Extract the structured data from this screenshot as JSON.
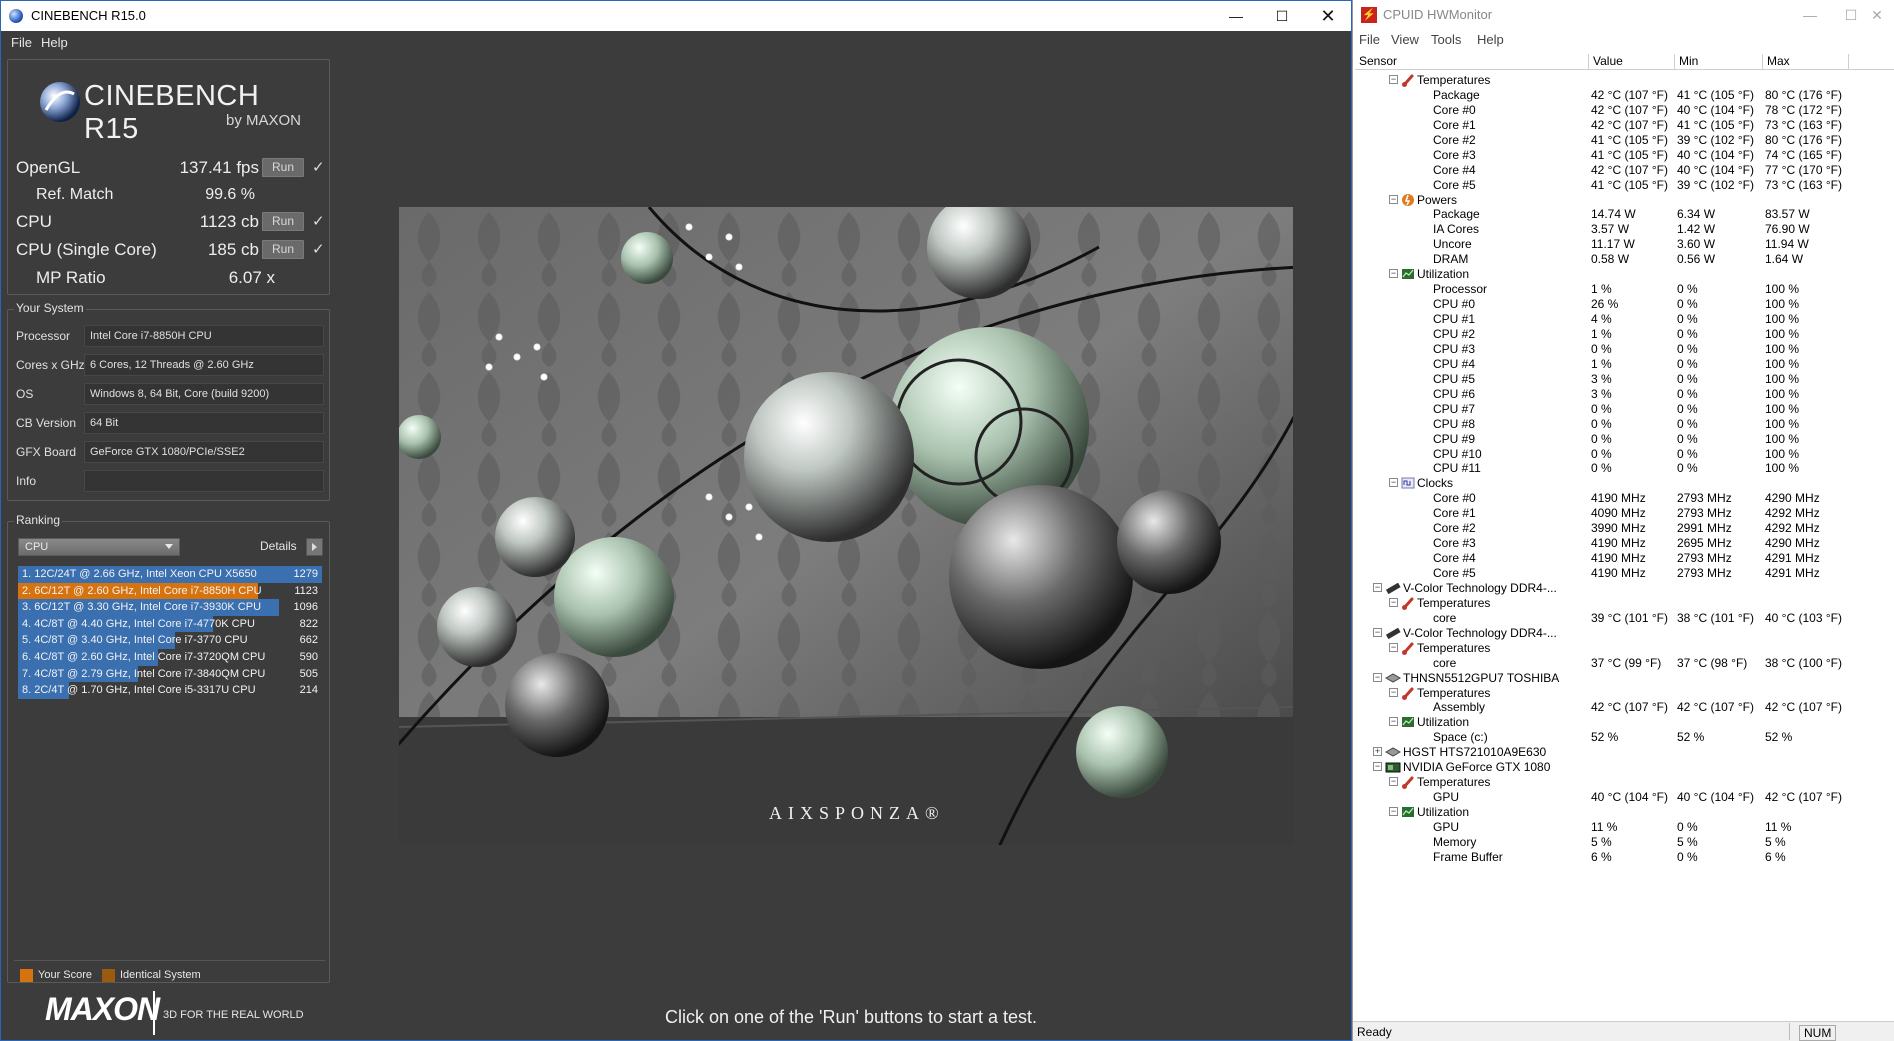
{
  "cinebench": {
    "title": "CINEBENCH R15.0",
    "menu": [
      "File",
      "Help"
    ],
    "logo": {
      "name": "CINEBENCH R15",
      "sub": "by MAXON"
    },
    "scores": [
      {
        "label": "OpenGL",
        "value": "137.41 fps",
        "run": "Run",
        "check": "✓"
      },
      {
        "label": "Ref. Match",
        "value": "99.6 %"
      },
      {
        "label": "CPU",
        "value": "1123 cb",
        "run": "Run",
        "check": "✓"
      },
      {
        "label": "CPU (Single Core)",
        "value": "185 cb",
        "run": "Run",
        "check": "✓"
      },
      {
        "label": "MP Ratio",
        "value": "6.07 x"
      }
    ],
    "your_system": {
      "heading": "Your System",
      "rows": [
        {
          "key": "Processor",
          "value": "Intel Core i7-8850H CPU"
        },
        {
          "key": "Cores x GHz",
          "value": "6 Cores, 12 Threads @ 2.60 GHz"
        },
        {
          "key": "OS",
          "value": "Windows 8, 64 Bit, Core (build 9200)"
        },
        {
          "key": "CB Version",
          "value": "64 Bit"
        },
        {
          "key": "GFX Board",
          "value": "GeForce GTX 1080/PCIe/SSE2"
        },
        {
          "key": "Info",
          "value": ""
        }
      ]
    },
    "ranking": {
      "heading": "Ranking",
      "select": "CPU",
      "details": "Details",
      "rows": [
        {
          "text": "1. 12C/24T @ 2.66 GHz, Intel Xeon CPU X5650",
          "score": 1279,
          "type": "other"
        },
        {
          "text": "2. 6C/12T @ 2.60 GHz, Intel Core i7-8850H CPU",
          "score": 1123,
          "type": "yours"
        },
        {
          "text": "3. 6C/12T @ 3.30 GHz,  Intel Core i7-3930K CPU",
          "score": 1096,
          "type": "other"
        },
        {
          "text": "4. 4C/8T @ 4.40 GHz, Intel Core i7-4770K CPU",
          "score": 822,
          "type": "other"
        },
        {
          "text": "5. 4C/8T @ 3.40 GHz,  Intel Core i7-3770 CPU",
          "score": 662,
          "type": "other"
        },
        {
          "text": "6. 4C/8T @ 2.60 GHz, Intel Core i7-3720QM CPU",
          "score": 590,
          "type": "other"
        },
        {
          "text": "7. 4C/8T @ 2.79 GHz, Intel Core i7-3840QM CPU",
          "score": 505,
          "type": "other"
        },
        {
          "text": "8. 2C/4T @ 1.70 GHz,  Intel Core i5-3317U CPU",
          "score": 214,
          "type": "other"
        }
      ],
      "legend": {
        "yours": "Your Score",
        "identical": "Identical System"
      }
    },
    "brand": {
      "logo": "MAXON",
      "tagline": "3D FOR THE REAL WORLD"
    },
    "render_watermark": "AIXSPONZA®",
    "status": "Click on one of the 'Run' buttons to start a test.",
    "colors": {
      "bg": "#3c3c3c",
      "bar_other": "#3a6fb0",
      "bar_yours": "#d6730f",
      "identical": "#9a5a10"
    }
  },
  "hwmonitor": {
    "title": "CPUID HWMonitor",
    "menu": [
      "File",
      "View",
      "Tools",
      "Help"
    ],
    "columns": [
      "Sensor",
      "Value",
      "Min",
      "Max"
    ],
    "status": "Ready",
    "status_right": "NUM",
    "rows": [
      {
        "lv": 2,
        "kind": "group",
        "icon": "thermometer-icon",
        "name": "Temperatures"
      },
      {
        "lv": 3,
        "name": "Package",
        "v": "42 °C  (107 °F)",
        "min": "41 °C  (105 °F)",
        "max": "80 °C  (176 °F)"
      },
      {
        "lv": 3,
        "name": "Core #0",
        "v": "42 °C  (107 °F)",
        "min": "40 °C  (104 °F)",
        "max": "78 °C  (172 °F)"
      },
      {
        "lv": 3,
        "name": "Core #1",
        "v": "42 °C  (107 °F)",
        "min": "41 °C  (105 °F)",
        "max": "73 °C  (163 °F)"
      },
      {
        "lv": 3,
        "name": "Core #2",
        "v": "41 °C  (105 °F)",
        "min": "39 °C  (102 °F)",
        "max": "80 °C  (176 °F)"
      },
      {
        "lv": 3,
        "name": "Core #3",
        "v": "41 °C  (105 °F)",
        "min": "40 °C  (104 °F)",
        "max": "74 °C  (165 °F)"
      },
      {
        "lv": 3,
        "name": "Core #4",
        "v": "42 °C  (107 °F)",
        "min": "40 °C  (104 °F)",
        "max": "77 °C  (170 °F)"
      },
      {
        "lv": 3,
        "name": "Core #5",
        "v": "41 °C  (105 °F)",
        "min": "39 °C  (102 °F)",
        "max": "73 °C  (163 °F)"
      },
      {
        "lv": 2,
        "kind": "group",
        "icon": "power-icon",
        "name": "Powers"
      },
      {
        "lv": 3,
        "name": "Package",
        "v": "14.74 W",
        "min": "6.34 W",
        "max": "83.57 W"
      },
      {
        "lv": 3,
        "name": "IA Cores",
        "v": "3.57 W",
        "min": "1.42 W",
        "max": "76.90 W"
      },
      {
        "lv": 3,
        "name": "Uncore",
        "v": "11.17 W",
        "min": "3.60 W",
        "max": "11.94 W"
      },
      {
        "lv": 3,
        "name": "DRAM",
        "v": "0.58 W",
        "min": "0.56 W",
        "max": "1.64 W"
      },
      {
        "lv": 2,
        "kind": "group",
        "icon": "utilization-icon",
        "name": "Utilization"
      },
      {
        "lv": 3,
        "name": "Processor",
        "v": "1 %",
        "min": "0 %",
        "max": "100 %"
      },
      {
        "lv": 3,
        "name": "CPU #0",
        "v": "26 %",
        "min": "0 %",
        "max": "100 %"
      },
      {
        "lv": 3,
        "name": "CPU #1",
        "v": "4 %",
        "min": "0 %",
        "max": "100 %"
      },
      {
        "lv": 3,
        "name": "CPU #2",
        "v": "1 %",
        "min": "0 %",
        "max": "100 %"
      },
      {
        "lv": 3,
        "name": "CPU #3",
        "v": "0 %",
        "min": "0 %",
        "max": "100 %"
      },
      {
        "lv": 3,
        "name": "CPU #4",
        "v": "1 %",
        "min": "0 %",
        "max": "100 %"
      },
      {
        "lv": 3,
        "name": "CPU #5",
        "v": "3 %",
        "min": "0 %",
        "max": "100 %"
      },
      {
        "lv": 3,
        "name": "CPU #6",
        "v": "3 %",
        "min": "0 %",
        "max": "100 %"
      },
      {
        "lv": 3,
        "name": "CPU #7",
        "v": "0 %",
        "min": "0 %",
        "max": "100 %"
      },
      {
        "lv": 3,
        "name": "CPU #8",
        "v": "0 %",
        "min": "0 %",
        "max": "100 %"
      },
      {
        "lv": 3,
        "name": "CPU #9",
        "v": "0 %",
        "min": "0 %",
        "max": "100 %"
      },
      {
        "lv": 3,
        "name": "CPU #10",
        "v": "0 %",
        "min": "0 %",
        "max": "100 %"
      },
      {
        "lv": 3,
        "name": "CPU #11",
        "v": "0 %",
        "min": "0 %",
        "max": "100 %"
      },
      {
        "lv": 2,
        "kind": "group",
        "icon": "clock-icon",
        "name": "Clocks"
      },
      {
        "lv": 3,
        "name": "Core #0",
        "v": "4190 MHz",
        "min": "2793 MHz",
        "max": "4290 MHz"
      },
      {
        "lv": 3,
        "name": "Core #1",
        "v": "4090 MHz",
        "min": "2793 MHz",
        "max": "4292 MHz"
      },
      {
        "lv": 3,
        "name": "Core #2",
        "v": "3990 MHz",
        "min": "2991 MHz",
        "max": "4292 MHz"
      },
      {
        "lv": 3,
        "name": "Core #3",
        "v": "4190 MHz",
        "min": "2695 MHz",
        "max": "4290 MHz"
      },
      {
        "lv": 3,
        "name": "Core #4",
        "v": "4190 MHz",
        "min": "2793 MHz",
        "max": "4291 MHz"
      },
      {
        "lv": 3,
        "name": "Core #5",
        "v": "4190 MHz",
        "min": "2793 MHz",
        "max": "4291 MHz"
      },
      {
        "lv": 1,
        "kind": "device",
        "icon": "memory-icon",
        "name": "V-Color Technology DDR4-..."
      },
      {
        "lv": 2,
        "kind": "group",
        "icon": "thermometer-icon",
        "name": "Temperatures"
      },
      {
        "lv": 3,
        "name": "core",
        "v": "39 °C  (101 °F)",
        "min": "38 °C  (101 °F)",
        "max": "40 °C  (103 °F)"
      },
      {
        "lv": 1,
        "kind": "device",
        "icon": "memory-icon",
        "name": "V-Color Technology DDR4-..."
      },
      {
        "lv": 2,
        "kind": "group",
        "icon": "thermometer-icon",
        "name": "Temperatures"
      },
      {
        "lv": 3,
        "name": "core",
        "v": "37 °C  (99 °F)",
        "min": "37 °C  (98 °F)",
        "max": "38 °C  (100 °F)"
      },
      {
        "lv": 1,
        "kind": "device",
        "icon": "disk-icon",
        "name": "THNSN5512GPU7 TOSHIBA"
      },
      {
        "lv": 2,
        "kind": "group",
        "icon": "thermometer-icon",
        "name": "Temperatures"
      },
      {
        "lv": 3,
        "name": "Assembly",
        "v": "42 °C  (107 °F)",
        "min": "42 °C  (107 °F)",
        "max": "42 °C  (107 °F)"
      },
      {
        "lv": 2,
        "kind": "group",
        "icon": "utilization-icon",
        "name": "Utilization"
      },
      {
        "lv": 3,
        "name": "Space (c:)",
        "v": "52 %",
        "min": "52 %",
        "max": "52 %"
      },
      {
        "lv": 1,
        "kind": "device",
        "icon": "disk-icon",
        "name": "HGST HTS721010A9E630",
        "collapsed": true
      },
      {
        "lv": 1,
        "kind": "device",
        "icon": "gpu-icon",
        "name": "NVIDIA GeForce GTX 1080"
      },
      {
        "lv": 2,
        "kind": "group",
        "icon": "thermometer-icon",
        "name": "Temperatures"
      },
      {
        "lv": 3,
        "name": "GPU",
        "v": "40 °C  (104 °F)",
        "min": "40 °C  (104 °F)",
        "max": "42 °C  (107 °F)"
      },
      {
        "lv": 2,
        "kind": "group",
        "icon": "utilization-icon",
        "name": "Utilization"
      },
      {
        "lv": 3,
        "name": "GPU",
        "v": "11 %",
        "min": "0 %",
        "max": "11 %"
      },
      {
        "lv": 3,
        "name": "Memory",
        "v": "5 %",
        "min": "5 %",
        "max": "5 %"
      },
      {
        "lv": 3,
        "name": "Frame Buffer",
        "v": "6 %",
        "min": "0 %",
        "max": "6 %"
      }
    ]
  }
}
